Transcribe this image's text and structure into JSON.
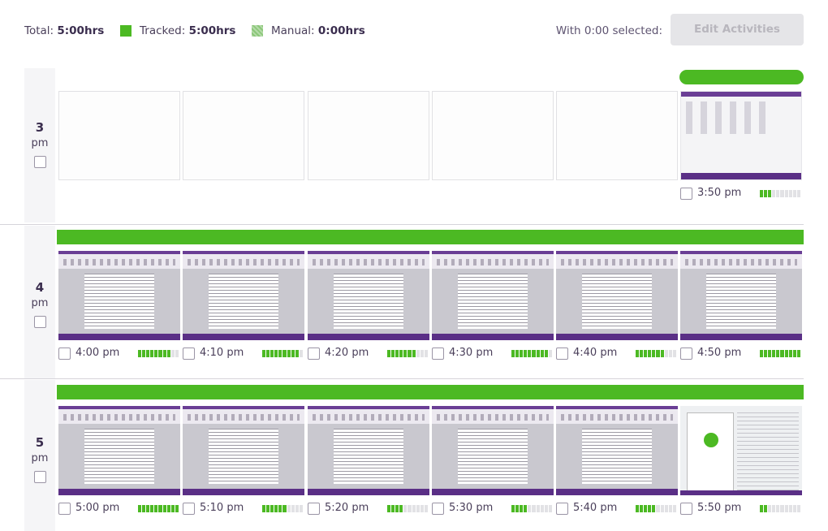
{
  "summary": {
    "total_label": "Total:",
    "total_value": "5:00hrs",
    "tracked_label": "Tracked:",
    "tracked_value": "5:00hrs",
    "manual_label": "Manual:",
    "manual_value": "0:00hrs",
    "selected_text": "With 0:00 selected:",
    "edit_button_label": "Edit Activities",
    "colors": {
      "tracked": "#4cb923",
      "manual": "#8cc77a",
      "accent": "#6a3e95"
    }
  },
  "hours": [
    {
      "num": "3",
      "ampm": "pm",
      "slots": [
        {
          "kind": "empty"
        },
        {
          "kind": "empty"
        },
        {
          "kind": "empty"
        },
        {
          "kind": "empty"
        },
        {
          "kind": "empty"
        },
        {
          "kind": "desktop",
          "time": "3:50 pm",
          "activity": 3
        }
      ]
    },
    {
      "num": "4",
      "ampm": "pm",
      "slots": [
        {
          "kind": "document",
          "time": "4:00 pm",
          "activity": 8
        },
        {
          "kind": "document",
          "time": "4:10 pm",
          "activity": 9
        },
        {
          "kind": "document",
          "time": "4:20 pm",
          "activity": 7
        },
        {
          "kind": "document",
          "time": "4:30 pm",
          "activity": 9
        },
        {
          "kind": "document",
          "time": "4:40 pm",
          "activity": 7
        },
        {
          "kind": "document",
          "time": "4:50 pm",
          "activity": 10
        }
      ]
    },
    {
      "num": "5",
      "ampm": "pm",
      "slots": [
        {
          "kind": "document",
          "time": "5:00 pm",
          "activity": 10
        },
        {
          "kind": "document",
          "time": "5:10 pm",
          "activity": 6
        },
        {
          "kind": "document",
          "time": "5:20 pm",
          "activity": 4
        },
        {
          "kind": "document",
          "time": "5:30 pm",
          "activity": 4
        },
        {
          "kind": "document",
          "time": "5:40 pm",
          "activity": 5
        },
        {
          "kind": "app",
          "time": "5:50 pm",
          "activity": 2
        }
      ]
    }
  ]
}
